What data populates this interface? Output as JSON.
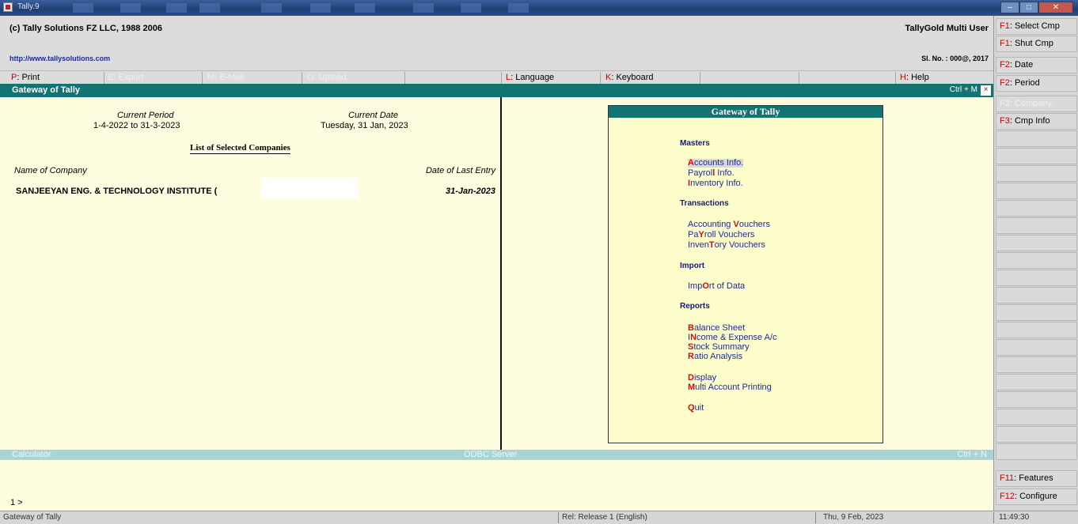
{
  "window": {
    "title": "Tally.9"
  },
  "header": {
    "copyright": "(c) Tally Solutions FZ LLC, 1988 2006",
    "product": "TallyGold   Multi User",
    "url": "http://www.tallysolutions.com",
    "serial": "Sl. No. : 000@, 2017"
  },
  "menubar": [
    {
      "key": "P",
      "label": ": Print",
      "enabled": true
    },
    {
      "key": "E",
      "label": ": Export",
      "enabled": false
    },
    {
      "key": "M",
      "label": ": E-Mail",
      "enabled": false
    },
    {
      "key": "O",
      "label": ": Upload",
      "enabled": false
    },
    {
      "key": "L",
      "label": ": Language",
      "enabled": true
    },
    {
      "key": "K",
      "label": ": Keyboard",
      "enabled": true
    },
    {
      "key": "H",
      "label": ": Help",
      "enabled": true
    }
  ],
  "gateway_bar": {
    "title": "Gateway of Tally",
    "shortcut": "Ctrl + M",
    "close": "×"
  },
  "left": {
    "current_period_label": "Current Period",
    "current_period": "1-4-2022 to 31-3-2023",
    "current_date_label": "Current Date",
    "current_date": "Tuesday, 31 Jan, 2023",
    "list_title": "List of Selected Companies",
    "col_name": "Name of Company",
    "col_date": "Date of Last Entry",
    "company_name": "SANJEEYAN ENG. & TECHNOLOGY INSTITUTE (",
    "company_last_entry": "31-Jan-2023"
  },
  "gateway_menu": {
    "title": "Gateway of Tally",
    "sections": {
      "masters": "Masters",
      "transactions": "Transactions",
      "import": "Import",
      "reports": "Reports"
    },
    "items": [
      {
        "pre": "",
        "key": "A",
        "post": "ccounts Info."
      },
      {
        "pre": "Payrol",
        "key": "l",
        "post": " Info."
      },
      {
        "pre": "",
        "key": "I",
        "post": "nventory Info."
      },
      {
        "pre": "Accounting ",
        "key": "V",
        "post": "ouchers"
      },
      {
        "pre": "Pa",
        "key": "Y",
        "post": "roll Vouchers"
      },
      {
        "pre": "Inven",
        "key": "T",
        "post": "ory Vouchers"
      },
      {
        "pre": "Imp",
        "key": "O",
        "post": "rt of Data"
      },
      {
        "pre": "",
        "key": "B",
        "post": "alance Sheet"
      },
      {
        "pre": "I",
        "key": "N",
        "post": "come & Expense A/c"
      },
      {
        "pre": "",
        "key": "S",
        "post": "tock Summary"
      },
      {
        "pre": "",
        "key": "R",
        "post": "atio Analysis"
      },
      {
        "pre": "",
        "key": "D",
        "post": "isplay"
      },
      {
        "pre": "",
        "key": "M",
        "post": "ulti Account Printing"
      },
      {
        "pre": "",
        "key": "Q",
        "post": "uit"
      }
    ]
  },
  "calculator": {
    "label": "Calculator",
    "odbc": "ODBC Server",
    "shortcut": "Ctrl + N",
    "prompt": "1    >"
  },
  "statusbar": {
    "left": "Gateway of Tally",
    "release": "Rel: Release 1 (English)",
    "date": "Thu, 9 Feb, 2023",
    "time": "11:49:30"
  },
  "rightbar": [
    {
      "key": "F1",
      "label": ": Select Cmp",
      "enabled": true
    },
    {
      "key": "F1",
      "label": ": Shut Cmp",
      "enabled": true
    },
    {
      "key": "F2",
      "label": ": Date",
      "enabled": true
    },
    {
      "key": "F2",
      "label": ": Period",
      "enabled": true
    },
    {
      "key": "F3",
      "label": ": Company",
      "enabled": false
    },
    {
      "key": "F3",
      "label": ": Cmp Info",
      "enabled": true
    },
    {
      "key": "F11",
      "label": ": Features",
      "enabled": true
    },
    {
      "key": "F12",
      "label": ": Configure",
      "enabled": true
    }
  ],
  "colors": {
    "teal_header": "#137272",
    "panel_bg": "#fdfdcb",
    "hotkey_red": "#cc0000",
    "menu_blue": "#1c2b99"
  }
}
